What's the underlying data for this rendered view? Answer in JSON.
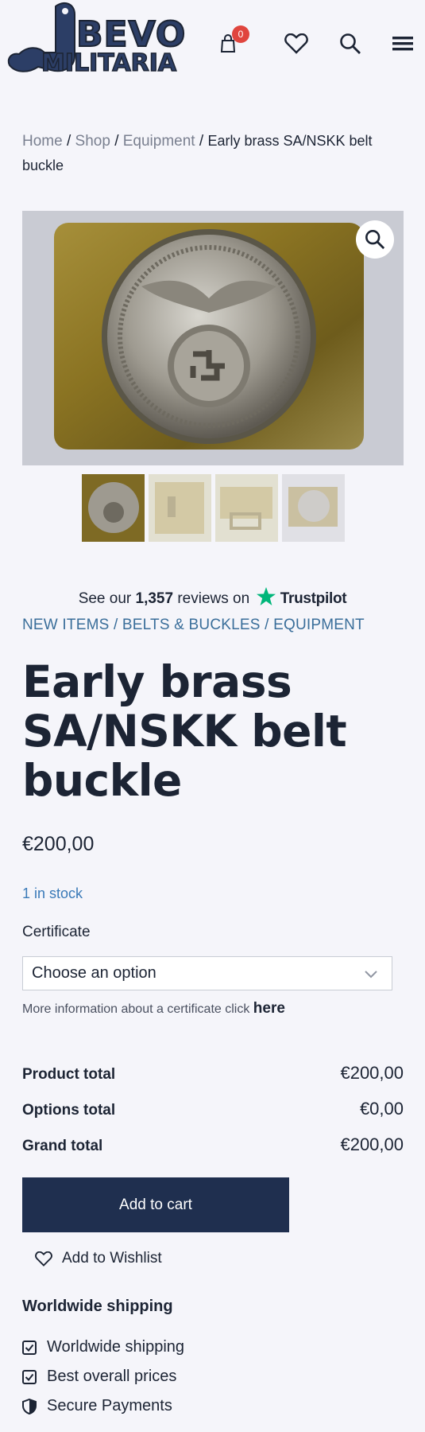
{
  "header": {
    "logo_line1": "BEVO",
    "logo_line2": "MILITARIA",
    "cart_count": "0",
    "icons": [
      "cart-icon",
      "heart-icon",
      "search-icon",
      "menu-icon"
    ]
  },
  "breadcrumb": {
    "items": [
      "Home",
      "Shop",
      "Equipment"
    ],
    "current": "Early brass SA/NSKK belt buckle",
    "separator": "/"
  },
  "gallery": {
    "zoom_icon": "search-icon",
    "thumbnail_count": 4
  },
  "trustpilot": {
    "prefix": "See our",
    "count": "1,357",
    "suffix": "reviews on",
    "brand": "Trustpilot"
  },
  "categories": {
    "items": [
      "NEW ITEMS",
      "BELTS & BUCKLES",
      "EQUIPMENT"
    ],
    "separator": "/"
  },
  "product": {
    "title": "Early brass SA/NSKK belt buckle",
    "price": "€200,00",
    "stock": "1 in stock"
  },
  "certificate": {
    "label": "Certificate",
    "selected": "Choose an option",
    "info_text": "More information about a certificate click",
    "info_link": "here"
  },
  "totals": {
    "product_label": "Product total",
    "product_value": "€200,00",
    "options_label": "Options total",
    "options_value": "€0,00",
    "grand_label": "Grand total",
    "grand_value": "€200,00"
  },
  "actions": {
    "add_to_cart": "Add to cart",
    "wishlist": "Add to Wishlist"
  },
  "shipping": {
    "title": "Worldwide shipping",
    "items": [
      {
        "label": "Worldwide shipping",
        "icon": "checkbox-icon"
      },
      {
        "label": "Best overall prices",
        "icon": "checkbox-icon"
      },
      {
        "label": "Secure Payments",
        "icon": "shield-icon"
      }
    ]
  },
  "colors": {
    "navy": "#1f2f4f",
    "link_blue": "#3a6e9a",
    "badge_red": "#e0453e",
    "trustpilot_green": "#00b67a"
  }
}
